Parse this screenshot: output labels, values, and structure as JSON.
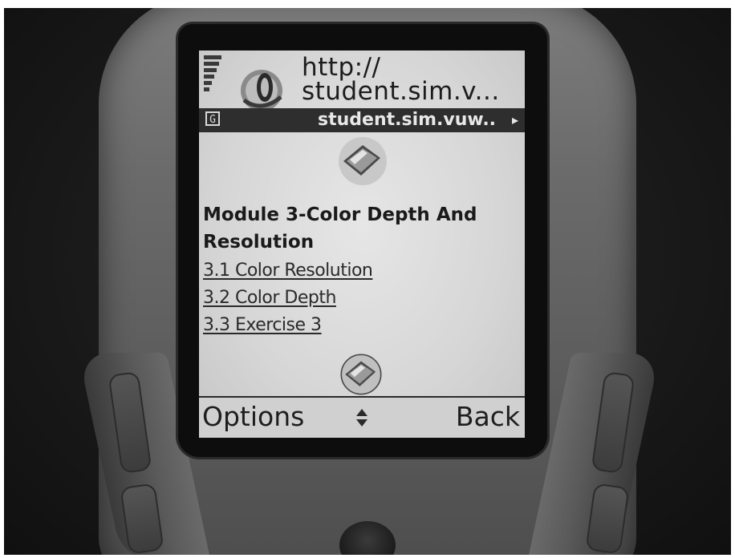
{
  "browser": {
    "url_line_1": "http://",
    "url_line_2": "student.sim.v...",
    "page_title": "student.sim.vuw.."
  },
  "content": {
    "heading": "Module 3-Color Depth And Resolution",
    "links": [
      {
        "label": "3.1 Color Resolution"
      },
      {
        "label": "3.2 Color Depth"
      },
      {
        "label": "3.3 Exercise 3"
      }
    ]
  },
  "softkeys": {
    "left": "Options",
    "right": "Back"
  },
  "icons": {
    "signal": "signal-strength-icon",
    "browser": "browser-icon",
    "title_prefix": "g-icon",
    "title_arrow": "arrow-right-icon",
    "top_image": "book-icon",
    "bottom_image": "book-icon",
    "scroll": "scroll-indicator-icon"
  },
  "icon_glyphs": {
    "title_prefix": "G"
  },
  "colors": {
    "screen_background": "#d6d6d6",
    "title_bar": "#2e2e2e",
    "text": "#1a1a1a"
  }
}
